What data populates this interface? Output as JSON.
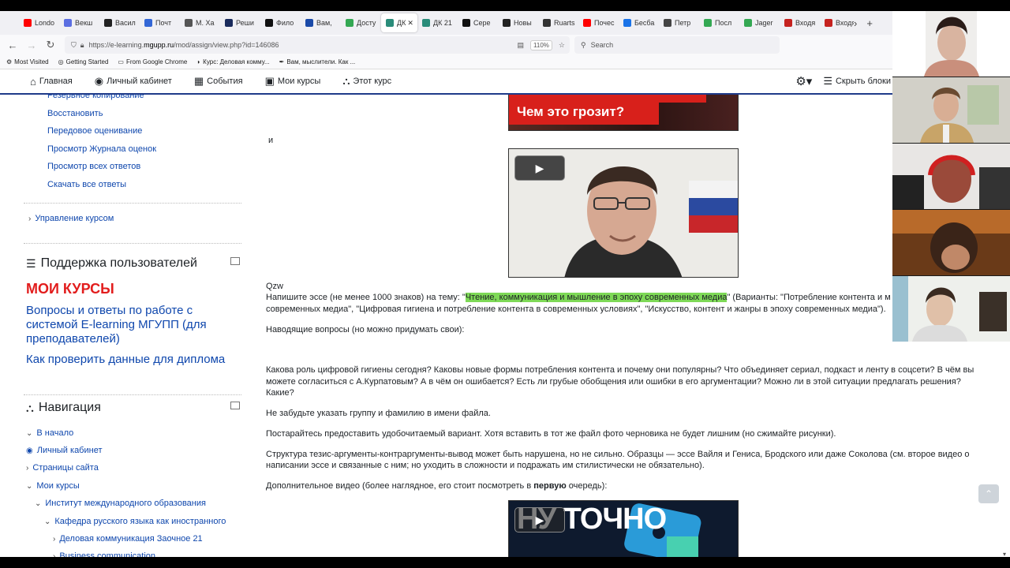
{
  "browser": {
    "tabs": [
      {
        "label": "Londo",
        "color": "#ff0000"
      },
      {
        "label": "Векш",
        "color": "#5b6ee1"
      },
      {
        "label": "Васил",
        "color": "#222222"
      },
      {
        "label": "Почт",
        "color": "#3367d6"
      },
      {
        "label": "М. Ха",
        "color": "#555555"
      },
      {
        "label": "Реши",
        "color": "#1a2b5c"
      },
      {
        "label": "Фило",
        "color": "#111111"
      },
      {
        "label": "Вам,",
        "color": "#1b4aa8"
      },
      {
        "label": "Досту",
        "color": "#34a853"
      },
      {
        "label": "ДК",
        "color": "#2a8c7a"
      },
      {
        "label": "ДК 21",
        "color": "#2a8c7a"
      },
      {
        "label": "Сере",
        "color": "#111111"
      },
      {
        "label": "Новы",
        "color": "#222222"
      },
      {
        "label": "Ruarts",
        "color": "#333333"
      },
      {
        "label": "Почес",
        "color": "#ff0000"
      },
      {
        "label": "Бесба",
        "color": "#1a73e8"
      },
      {
        "label": "Петр",
        "color": "#444444"
      },
      {
        "label": "Посл",
        "color": "#34a853"
      },
      {
        "label": "Jager",
        "color": "#34a853"
      },
      {
        "label": "Входя",
        "color": "#c5221f"
      },
      {
        "label": "Входя",
        "color": "#c5221f"
      }
    ],
    "active_tab_index": 9,
    "url_prefix": "https://e-learning.",
    "url_host": "mgupp.ru",
    "url_path": "/mod/assign/view.php?id=146086",
    "zoom": "110%",
    "search_placeholder": "Search",
    "bookmarks": [
      {
        "label": "Most Visited",
        "icon": "gear-icon"
      },
      {
        "label": "Getting Started",
        "icon": "globe-icon"
      },
      {
        "label": "From Google Chrome",
        "icon": "folder-icon"
      },
      {
        "label": "Курс: Деловая комму...",
        "icon": "moodle-icon"
      },
      {
        "label": "Вам, мыслители. Как ...",
        "icon": "feather-icon"
      }
    ]
  },
  "moodle_nav": {
    "items": [
      {
        "label": "Главная",
        "icon": "home-icon"
      },
      {
        "label": "Личный кабинет",
        "icon": "dashboard-icon"
      },
      {
        "label": "События",
        "icon": "calendar-icon"
      },
      {
        "label": "Мои курсы",
        "icon": "briefcase-icon"
      },
      {
        "label": "Этот курс",
        "icon": "sitemap-icon"
      }
    ],
    "hide_blocks": "Скрыть блоки"
  },
  "sidebar": {
    "admin_links": [
      "Резервное копирование",
      "Восстановить",
      "Передовое оценивание",
      "Просмотр Журнала оценок",
      "Просмотр всех ответов",
      "Скачать все ответы"
    ],
    "course_admin": "Управление курсом",
    "support_title": "Поддержка пользователей",
    "my_courses_heading": "МОИ КУРСЫ",
    "support_links": [
      "Вопросы и ответы по работе с системой E-learning МГУПП (для преподавателей)",
      "Как проверить данные для диплома"
    ],
    "navigation_title": "Навигация",
    "navigation": [
      {
        "label": "В начало",
        "level": 0,
        "chev": "down"
      },
      {
        "label": "Личный кабинет",
        "level": 0,
        "chev": "icon"
      },
      {
        "label": "Страницы сайта",
        "level": 0,
        "chev": "right"
      },
      {
        "label": "Мои курсы",
        "level": 0,
        "chev": "down"
      },
      {
        "label": "Институт международного образования",
        "level": 1,
        "chev": "down"
      },
      {
        "label": "Кафедра русского языка как иностранного",
        "level": 2,
        "chev": "down"
      },
      {
        "label": "Деловая коммуникация Заочное 21",
        "level": 3,
        "chev": "right"
      },
      {
        "label": "Business communication",
        "level": 3,
        "chev": "right"
      }
    ]
  },
  "content": {
    "video1_caption": "Чем это грозит?",
    "conj": "и",
    "author": "Qzw",
    "task_prefix": "Напишите эссе (не менее 1000 знаков) на тему: \"",
    "task_highlight": "Чтение, коммуникация и мышление в эпоху современных медиа",
    "task_suffix": "\" (Варианты: \"Потребление контента и м",
    "task_line2": "современных медиа\", \"Цифровая гигиена и потребление контента в современных условиях\", \"Искусство, контент и жанры в эпоху современных медиа\").",
    "guiding": "Наводящие вопросы (но можно придумать свои):",
    "questions_l1": "Какова роль цифровой гигиены сегодня? Каковы новые формы потребления контента и почему они популярны? Что объединяет сериал, подкаст и ленту в соцсети? В чём вы",
    "questions_l2": "можете согласиться с А.Курпатовым? А в чём он ошибается? Есть ли грубые обобщения или ошибки в его аргументации? Можно ли в этой ситуации предлагать решения?",
    "questions_l3": "Какие?",
    "p_name": "Не забудьте указать группу и фамилию в имени файла.",
    "p_readable": "Постарайтесь предоставить удобочитаемый вариант. Хотя вставить в тот же файл фото черновика не будет лишним (но сжимайте рисунки).",
    "p_structure_l1": "Структура тезис-аргументы-контраргументы-вывод может быть нарушена, но не сильно. Образцы — эссе Вайля и Гениса, Бродского или даже Соколова (см. второе видео о",
    "p_structure_l2": "написании эссе и связанные с ним; но уходить в сложности и подражать им стилистически не обязательно).",
    "p_extra_prefix": "Дополнительное видео (более наглядное, его стоит посмотреть в ",
    "p_extra_bold": "первую",
    "p_extra_suffix": " очередь):",
    "video3_caption": "НУ ТОЧНО"
  },
  "colors": {
    "link": "#0f47ad",
    "red_heading": "#e21d1d",
    "highlight": "#7ed957",
    "moodle_nav_border": "#1f3b8a"
  }
}
